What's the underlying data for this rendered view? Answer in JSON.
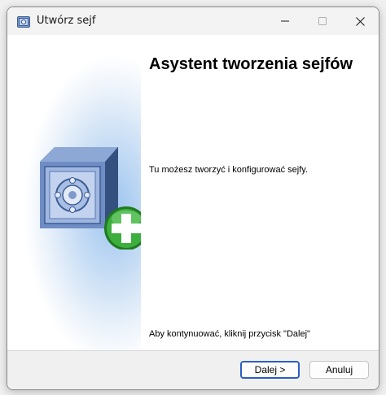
{
  "window": {
    "title": "Utwórz sejf",
    "controls": {
      "minimize": "minimize-icon",
      "maximize": "maximize-icon",
      "close": "close-icon"
    }
  },
  "wizard": {
    "heading": "Asystent tworzenia sejfów",
    "description": "Tu możesz tworzyć i konfigurować sejfy.",
    "continue_hint": "Aby kontynuować, kliknij przycisk \"Dalej\""
  },
  "footer": {
    "next_label": "Dalej >",
    "cancel_label": "Anuluj"
  },
  "colors": {
    "accent": "#2b5fc0",
    "plus_green": "#2e9e2e",
    "safe_blue": "#5a78ae"
  }
}
